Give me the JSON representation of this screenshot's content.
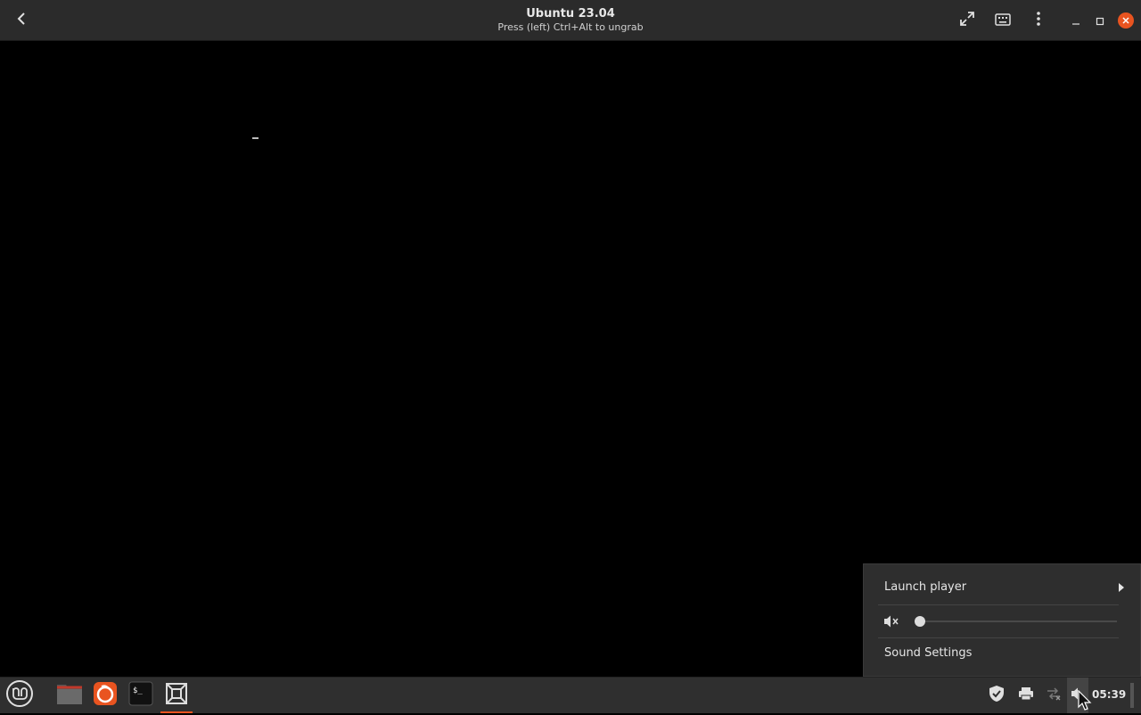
{
  "window": {
    "title": "Ubuntu 23.04",
    "subtitle": "Press (left) Ctrl+Alt to ungrab"
  },
  "sound_menu": {
    "launch_player": "Launch player",
    "volume_percent": 0,
    "muted": true,
    "sound_settings": "Sound Settings"
  },
  "panel": {
    "clock": "05:39",
    "launchers": [
      "files-icon",
      "firefox-icon",
      "terminal-icon",
      "gnome-boxes-icon"
    ]
  },
  "colors": {
    "accent": "#e95420",
    "titlebar": "#2b2b2b",
    "panel": "#2f2f2f",
    "popup": "#2e2e2e"
  }
}
